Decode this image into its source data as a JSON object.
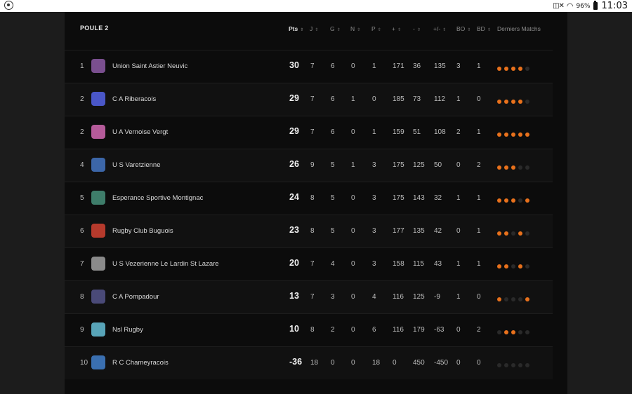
{
  "status_bar": {
    "battery": "96%",
    "time": "11:03"
  },
  "colors": {
    "accent": "#e8711c",
    "dot_empty": "#2a2a2a"
  },
  "table": {
    "title": "POULE 2",
    "headers": {
      "pts": "Pts",
      "j": "J",
      "g": "G",
      "n": "N",
      "p": "P",
      "plus": "+",
      "minus": "-",
      "diff": "+/-",
      "bo": "BO",
      "bd": "BD",
      "last": "Derniers Matchs"
    },
    "rows": [
      {
        "rank": "1",
        "team": "Union Saint Astier Neuvic",
        "logo_color": "#7a4f8f",
        "pts": "30",
        "j": "7",
        "g": "6",
        "n": "0",
        "p": "1",
        "plus": "171",
        "minus": "36",
        "diff": "135",
        "bo": "3",
        "bd": "1",
        "last": [
          1,
          1,
          1,
          1,
          0
        ]
      },
      {
        "rank": "2",
        "team": "C A Riberacois",
        "logo_color": "#4a57c8",
        "pts": "29",
        "j": "7",
        "g": "6",
        "n": "1",
        "p": "0",
        "plus": "185",
        "minus": "73",
        "diff": "112",
        "bo": "1",
        "bd": "0",
        "last": [
          1,
          1,
          1,
          1,
          0
        ]
      },
      {
        "rank": "2",
        "team": "U A Vernoise Vergt",
        "logo_color": "#b55b9a",
        "pts": "29",
        "j": "7",
        "g": "6",
        "n": "0",
        "p": "1",
        "plus": "159",
        "minus": "51",
        "diff": "108",
        "bo": "2",
        "bd": "1",
        "last": [
          1,
          1,
          1,
          1,
          1
        ]
      },
      {
        "rank": "4",
        "team": "U S Varetzienne",
        "logo_color": "#3c66a8",
        "pts": "26",
        "j": "9",
        "g": "5",
        "n": "1",
        "p": "3",
        "plus": "175",
        "minus": "125",
        "diff": "50",
        "bo": "0",
        "bd": "2",
        "last": [
          1,
          1,
          1,
          0,
          0
        ]
      },
      {
        "rank": "5",
        "team": "Esperance Sportive Montignac",
        "logo_color": "#3e7d6a",
        "pts": "24",
        "j": "8",
        "g": "5",
        "n": "0",
        "p": "3",
        "plus": "175",
        "minus": "143",
        "diff": "32",
        "bo": "1",
        "bd": "1",
        "last": [
          1,
          1,
          1,
          0,
          1
        ]
      },
      {
        "rank": "6",
        "team": "Rugby Club Buguois",
        "logo_color": "#b63a2c",
        "pts": "23",
        "j": "8",
        "g": "5",
        "n": "0",
        "p": "3",
        "plus": "177",
        "minus": "135",
        "diff": "42",
        "bo": "0",
        "bd": "1",
        "last": [
          1,
          1,
          0,
          1,
          0
        ]
      },
      {
        "rank": "7",
        "team": "U S Vezerienne Le Lardin St Lazare",
        "logo_color": "#8a8a8a",
        "pts": "20",
        "j": "7",
        "g": "4",
        "n": "0",
        "p": "3",
        "plus": "158",
        "minus": "115",
        "diff": "43",
        "bo": "1",
        "bd": "1",
        "last": [
          1,
          1,
          0,
          1,
          0
        ]
      },
      {
        "rank": "8",
        "team": "C A Pompadour",
        "logo_color": "#4a4a78",
        "pts": "13",
        "j": "7",
        "g": "3",
        "n": "0",
        "p": "4",
        "plus": "116",
        "minus": "125",
        "diff": "-9",
        "bo": "1",
        "bd": "0",
        "last": [
          1,
          0,
          0,
          0,
          1
        ]
      },
      {
        "rank": "9",
        "team": "Nsl Rugby",
        "logo_color": "#58a4b8",
        "pts": "10",
        "j": "8",
        "g": "2",
        "n": "0",
        "p": "6",
        "plus": "116",
        "minus": "179",
        "diff": "-63",
        "bo": "0",
        "bd": "2",
        "last": [
          0,
          1,
          1,
          0,
          0
        ]
      },
      {
        "rank": "10",
        "team": "R C Chameyracois",
        "logo_color": "#3a6fb0",
        "pts": "-36",
        "j": "18",
        "g": "0",
        "n": "0",
        "p": "18",
        "plus": "0",
        "minus": "450",
        "diff": "-450",
        "bo": "0",
        "bd": "0",
        "last": [
          0,
          0,
          0,
          0,
          0
        ]
      }
    ]
  }
}
